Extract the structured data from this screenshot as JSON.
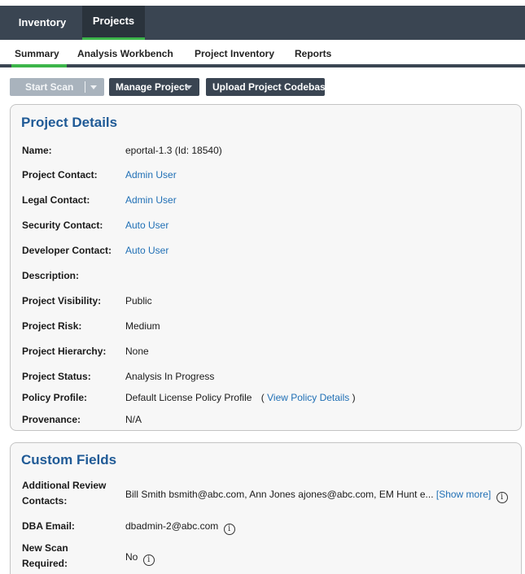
{
  "nav": {
    "tabs": [
      {
        "label": "Inventory",
        "active": false
      },
      {
        "label": "Projects",
        "active": true
      }
    ]
  },
  "subnav": {
    "items": [
      {
        "label": "Summary",
        "active": true
      },
      {
        "label": "Analysis Workbench",
        "active": false
      },
      {
        "label": "Project Inventory",
        "active": false
      },
      {
        "label": "Reports",
        "active": false
      }
    ]
  },
  "toolbar": {
    "start_scan": "Start Scan",
    "manage_project": "Manage Project",
    "upload_codebase": "Upload Project Codebase"
  },
  "project_details": {
    "title": "Project Details",
    "rows": [
      {
        "label": "Name:",
        "value": "eportal-1.3 (Id: 18540)"
      },
      {
        "label": "Project Contact:",
        "value": "Admin User"
      },
      {
        "label": "Legal Contact:",
        "value": "Admin User"
      },
      {
        "label": "Security Contact:",
        "value": "Auto User"
      },
      {
        "label": "Developer Contact:",
        "value": "Auto User"
      },
      {
        "label": "Description:",
        "value": ""
      },
      {
        "label": "Project Visibility:",
        "value": "Public"
      },
      {
        "label": "Project Risk:",
        "value": "Medium"
      },
      {
        "label": "Project Hierarchy:",
        "value": "None"
      },
      {
        "label": "Project Status:",
        "value": "Analysis In Progress"
      },
      {
        "label": "Policy Profile:",
        "value": "Default License Policy Profile",
        "open_paren": "(",
        "link": "View Policy Details",
        "close_paren": ")"
      },
      {
        "label": "Provenance:",
        "value": "N/A"
      }
    ]
  },
  "custom_fields": {
    "title": "Custom Fields",
    "rows": [
      {
        "label": "Additional Review Contacts:",
        "value": "Bill Smith bsmith@abc.com, Ann Jones ajones@abc.com, EM Hunt e...",
        "link": "[Show more]",
        "icon": "info-icon",
        "icon_glyph": "i"
      },
      {
        "label": "DBA Email:",
        "value": "dbadmin-2@abc.com",
        "icon": "info-icon",
        "icon_glyph": "i"
      },
      {
        "label": "New Scan Required:",
        "value": "No",
        "icon": "info-icon",
        "icon_glyph": "i"
      }
    ]
  },
  "colors": {
    "nav_bg": "#3a4552",
    "accent_green": "#3cb54a",
    "title_blue": "#1f5a96",
    "link_blue": "#1f6fb5",
    "disabled_button": "#a9b3bd"
  }
}
